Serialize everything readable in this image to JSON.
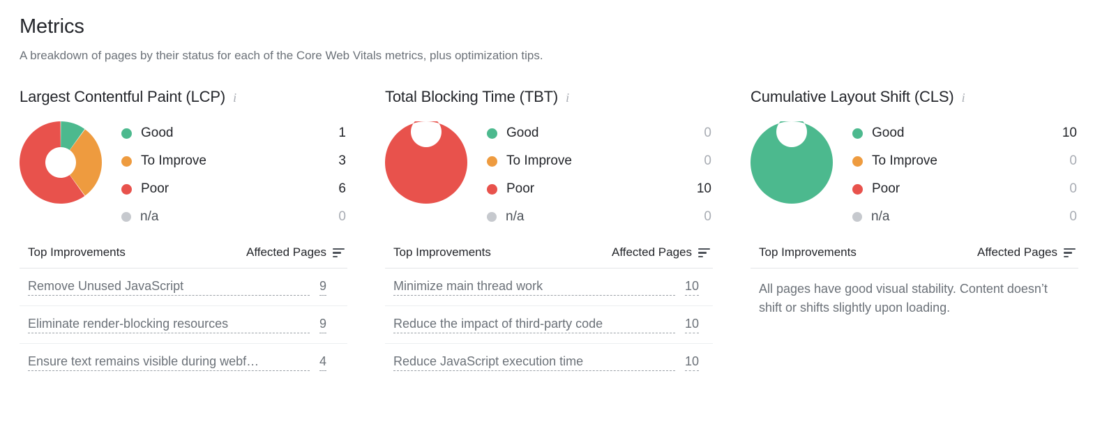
{
  "header": {
    "title": "Metrics",
    "subtitle": "A breakdown of pages by their status for each of the Core Web Vitals metrics, plus optimization tips."
  },
  "table_headers": {
    "improvements": "Top Improvements",
    "affected_pages": "Affected Pages",
    "sort_icon": "sort-descending-icon"
  },
  "colors": {
    "good": "#4cb98e",
    "to_improve": "#ee9b3f",
    "poor": "#e8524c",
    "na": "#c6c9ce",
    "text_dark": "#23252a",
    "text_muted": "#6b7178",
    "text_disabled": "#a8acb3",
    "divider": "#e4e6e8"
  },
  "info_icon": "info-icon",
  "metrics": [
    {
      "id": "lcp",
      "title": "Largest Contentful Paint (LCP)",
      "legend": [
        {
          "label": "Good",
          "value": "1",
          "color_key": "good",
          "zero": false
        },
        {
          "label": "To Improve",
          "value": "3",
          "color_key": "to_improve",
          "zero": false
        },
        {
          "label": "Poor",
          "value": "6",
          "color_key": "poor",
          "zero": false
        },
        {
          "label": "n/a",
          "value": "0",
          "color_key": "na",
          "zero": true
        }
      ],
      "improvements": [
        {
          "name": "Remove Unused JavaScript",
          "count": "9"
        },
        {
          "name": "Eliminate render-blocking resources",
          "count": "9"
        },
        {
          "name": "Ensure text remains visible during webf…",
          "count": "4"
        }
      ],
      "empty_note": ""
    },
    {
      "id": "tbt",
      "title": "Total Blocking Time (TBT)",
      "legend": [
        {
          "label": "Good",
          "value": "0",
          "color_key": "good",
          "zero": true
        },
        {
          "label": "To Improve",
          "value": "0",
          "color_key": "to_improve",
          "zero": true
        },
        {
          "label": "Poor",
          "value": "10",
          "color_key": "poor",
          "zero": false
        },
        {
          "label": "n/a",
          "value": "0",
          "color_key": "na",
          "zero": true
        }
      ],
      "improvements": [
        {
          "name": "Minimize main thread work",
          "count": "10"
        },
        {
          "name": "Reduce the impact of third-party code",
          "count": "10"
        },
        {
          "name": "Reduce JavaScript execution time",
          "count": "10"
        }
      ],
      "empty_note": ""
    },
    {
      "id": "cls",
      "title": "Cumulative Layout Shift (CLS)",
      "legend": [
        {
          "label": "Good",
          "value": "10",
          "color_key": "good",
          "zero": false
        },
        {
          "label": "To Improve",
          "value": "0",
          "color_key": "to_improve",
          "zero": true
        },
        {
          "label": "Poor",
          "value": "0",
          "color_key": "poor",
          "zero": true
        },
        {
          "label": "n/a",
          "value": "0",
          "color_key": "na",
          "zero": true
        }
      ],
      "improvements": [],
      "empty_note": "All pages have good visual stability. Content doesn’t shift or shifts slightly upon loading."
    }
  ],
  "chart_data": [
    {
      "type": "pie",
      "title": "Largest Contentful Paint (LCP)",
      "categories": [
        "Good",
        "To Improve",
        "Poor",
        "n/a"
      ],
      "values": [
        1,
        3,
        6,
        0
      ],
      "colors": [
        "#4cb98e",
        "#ee9b3f",
        "#e8524c",
        "#c6c9ce"
      ],
      "total": 10,
      "donut": true,
      "legend_position": "right"
    },
    {
      "type": "pie",
      "title": "Total Blocking Time (TBT)",
      "categories": [
        "Good",
        "To Improve",
        "Poor",
        "n/a"
      ],
      "values": [
        0,
        0,
        10,
        0
      ],
      "colors": [
        "#4cb98e",
        "#ee9b3f",
        "#e8524c",
        "#c6c9ce"
      ],
      "total": 10,
      "donut": true,
      "legend_position": "right"
    },
    {
      "type": "pie",
      "title": "Cumulative Layout Shift (CLS)",
      "categories": [
        "Good",
        "To Improve",
        "Poor",
        "n/a"
      ],
      "values": [
        10,
        0,
        0,
        0
      ],
      "colors": [
        "#4cb98e",
        "#ee9b3f",
        "#e8524c",
        "#c6c9ce"
      ],
      "total": 10,
      "donut": true,
      "legend_position": "right"
    }
  ]
}
